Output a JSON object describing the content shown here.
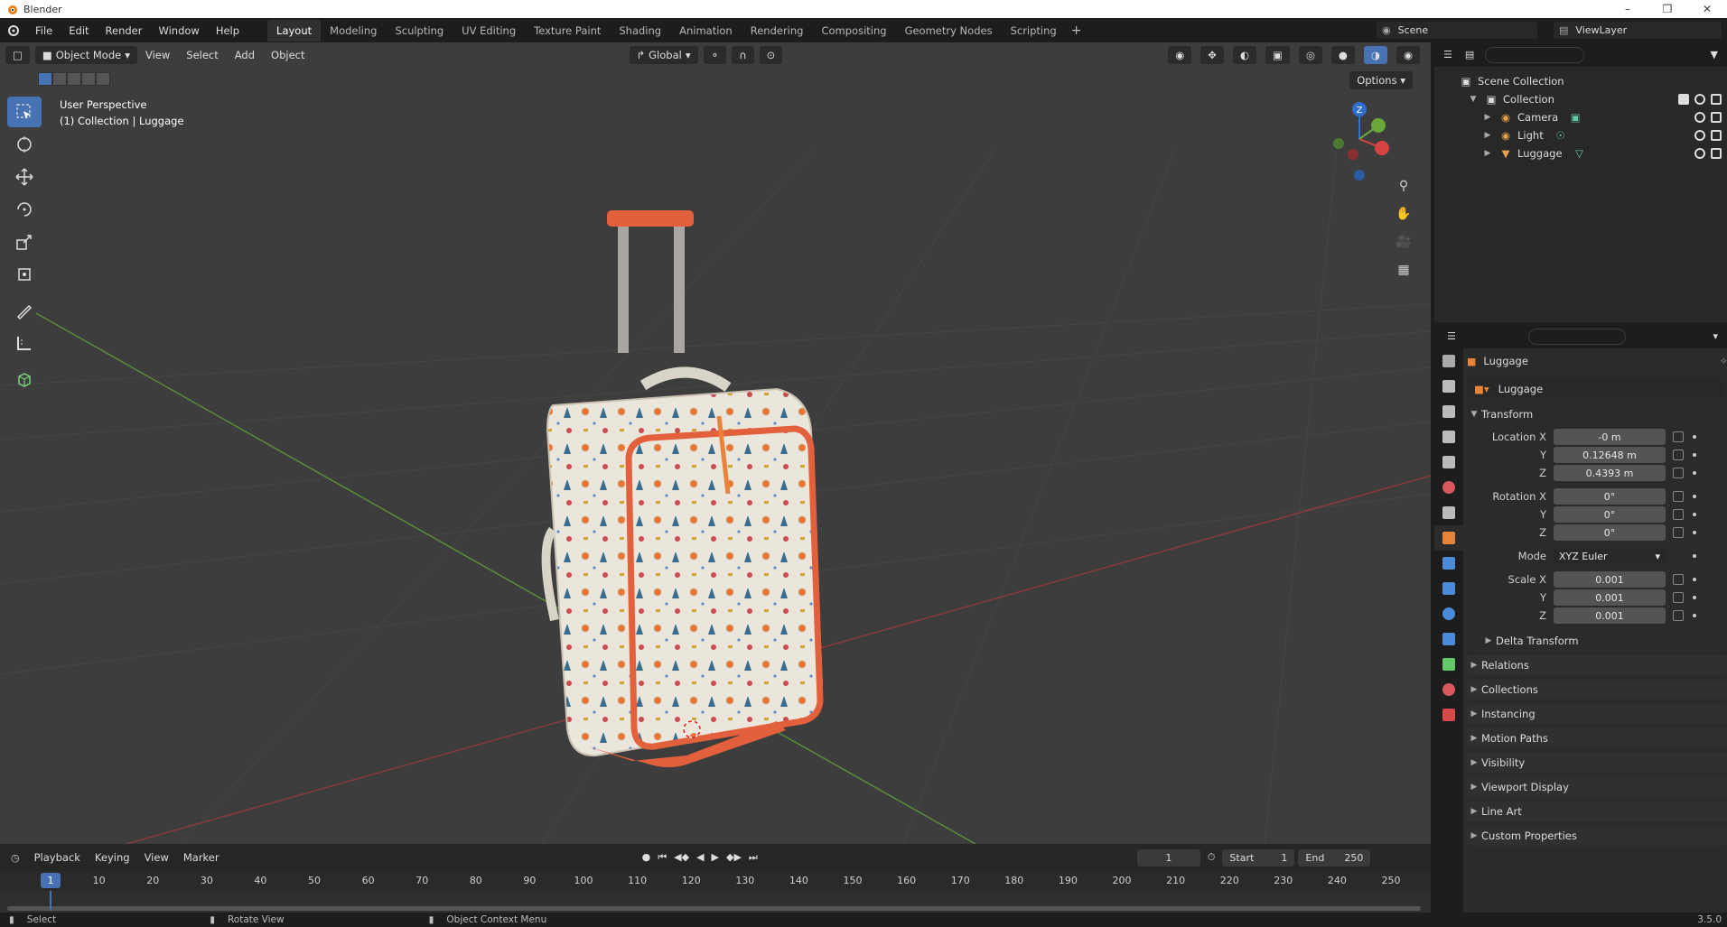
{
  "window": {
    "title": "Blender",
    "version": "3.5.0"
  },
  "menu": [
    "File",
    "Edit",
    "Render",
    "Window",
    "Help"
  ],
  "workspaces": [
    "Layout",
    "Modeling",
    "Sculpting",
    "UV Editing",
    "Texture Paint",
    "Shading",
    "Animation",
    "Rendering",
    "Compositing",
    "Geometry Nodes",
    "Scripting"
  ],
  "active_workspace": "Layout",
  "scene": {
    "name": "Scene",
    "view_layer": "ViewLayer"
  },
  "viewport": {
    "mode": "Object Mode",
    "menus": [
      "View",
      "Select",
      "Add",
      "Object"
    ],
    "transform_orientation": "Global",
    "perspective_label": "User Perspective",
    "collection_label": "(1) Collection | Luggage",
    "options_label": "Options",
    "gizmo_axis": "Z"
  },
  "tools": [
    "select-box",
    "cursor",
    "move",
    "rotate",
    "scale",
    "transform",
    "annotate",
    "measure",
    "add-cube"
  ],
  "outliner": {
    "root": "Scene Collection",
    "collection": "Collection",
    "items": [
      {
        "name": "Camera",
        "icon": "camera-icon",
        "color": "#e8a04a"
      },
      {
        "name": "Light",
        "icon": "light-icon",
        "color": "#e8a04a"
      },
      {
        "name": "Luggage",
        "icon": "mesh-icon",
        "color": "#e8a04a"
      }
    ]
  },
  "properties": {
    "object_name": "Luggage",
    "data_name": "Luggage",
    "transform_title": "Transform",
    "location": {
      "label": "Location X",
      "x": "-0 m",
      "y": "0.12648 m",
      "z": "0.4393 m"
    },
    "rotation": {
      "label": "Rotation X",
      "x": "0°",
      "y": "0°",
      "z": "0°"
    },
    "mode": {
      "label": "Mode",
      "value": "XYZ Euler"
    },
    "scale": {
      "label": "Scale X",
      "x": "0.001",
      "y": "0.001",
      "z": "0.001"
    },
    "axis_y": "Y",
    "axis_z": "Z",
    "delta": "Delta Transform",
    "panels": [
      "Relations",
      "Collections",
      "Instancing",
      "Motion Paths",
      "Visibility",
      "Viewport Display",
      "Line Art",
      "Custom Properties"
    ]
  },
  "timeline": {
    "menus": [
      "Playback",
      "Keying",
      "View",
      "Marker"
    ],
    "current_frame": "1",
    "start_label": "Start",
    "start": "1",
    "end_label": "End",
    "end": "250",
    "ticks": [
      "1",
      "10",
      "20",
      "30",
      "40",
      "50",
      "60",
      "70",
      "80",
      "90",
      "100",
      "110",
      "120",
      "130",
      "140",
      "150",
      "160",
      "170",
      "180",
      "190",
      "200",
      "210",
      "220",
      "230",
      "240",
      "250"
    ]
  },
  "status": {
    "select": "Select",
    "rotate": "Rotate View",
    "context": "Object Context Menu",
    "version": "3.5.0"
  }
}
